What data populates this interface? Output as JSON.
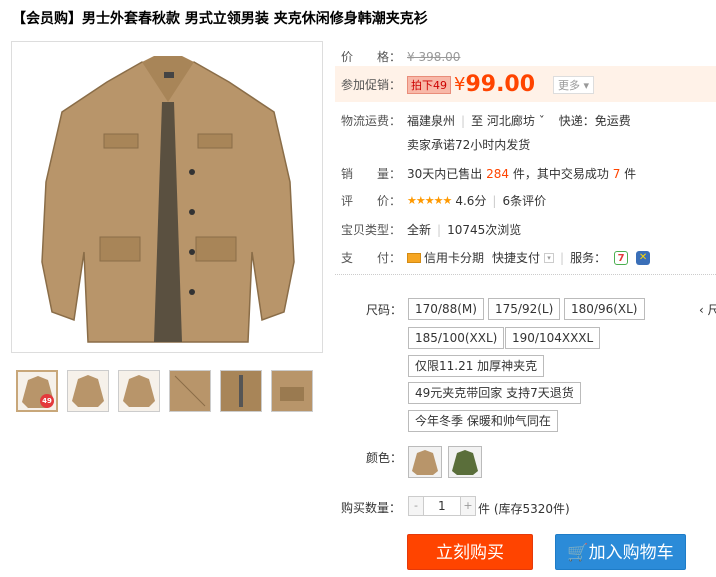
{
  "title": "【会员购】男士外套春秋款 男式立领男装 夹克休闲修身韩潮夹克衫",
  "price": {
    "label": "价　　格：",
    "original": "¥ 398.00"
  },
  "promo": {
    "label": "参加促销：",
    "tag": "拍下49",
    "currency": "¥",
    "value": "99.00",
    "more": "更多"
  },
  "shipping": {
    "label": "物流运费：",
    "from": "福建泉州",
    "to": "河北廊坊",
    "method": "快递：免运费",
    "note": "卖家承诺72小时内发货"
  },
  "sales": {
    "label": "销　　量：",
    "prefix": "30天内已售出",
    "sold": "284",
    "mid": "件，其中交易成功",
    "success": "7",
    "suffix": "件"
  },
  "rating": {
    "label": "评　　价：",
    "stars": "★★★★★",
    "score": "4.6分",
    "reviews": "6条评价"
  },
  "item_type": {
    "label": "宝贝类型：",
    "condition": "全新",
    "views": "10745次浏览"
  },
  "payment": {
    "label": "支　　付：",
    "installment": "信用卡分期",
    "quick": "快捷支付",
    "service_label": "服务："
  },
  "size": {
    "label": "尺码：",
    "options": [
      "170/88(M)",
      "175/92(L)",
      "180/96(XL)",
      "185/100(XXL)",
      "190/104XXXL"
    ]
  },
  "notes": [
    "仅限11.21 加厚神夹克",
    "49元夹克带回家 支持7天退货",
    "今年冬季 保暖和帅气同在"
  ],
  "color_label": "颜色：",
  "quantity": {
    "label": "购买数量：",
    "value": "1",
    "minus": "-",
    "plus": "+",
    "stock": "件 (库存5320件)"
  },
  "buttons": {
    "buy": "立刻购买",
    "cart": "加入购物车"
  },
  "colors": {
    "accent": "#ff4400",
    "cart": "#2b8bd8",
    "khaki": "#b8956a",
    "green": "#5a6e3a"
  }
}
